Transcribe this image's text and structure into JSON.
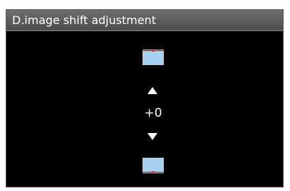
{
  "screen": {
    "title": "D.image shift adjustment",
    "value": "+0",
    "icons": {
      "top_box": "image-shift-top-preview-icon",
      "bottom_box": "image-shift-bottom-preview-icon",
      "up": "triangle-up-icon",
      "down": "triangle-down-icon"
    },
    "colors": {
      "background": "#000000",
      "title_bar": "#5a5a5a",
      "preview_fill": "#a8d0f0",
      "marker": "#e01a3c"
    }
  }
}
